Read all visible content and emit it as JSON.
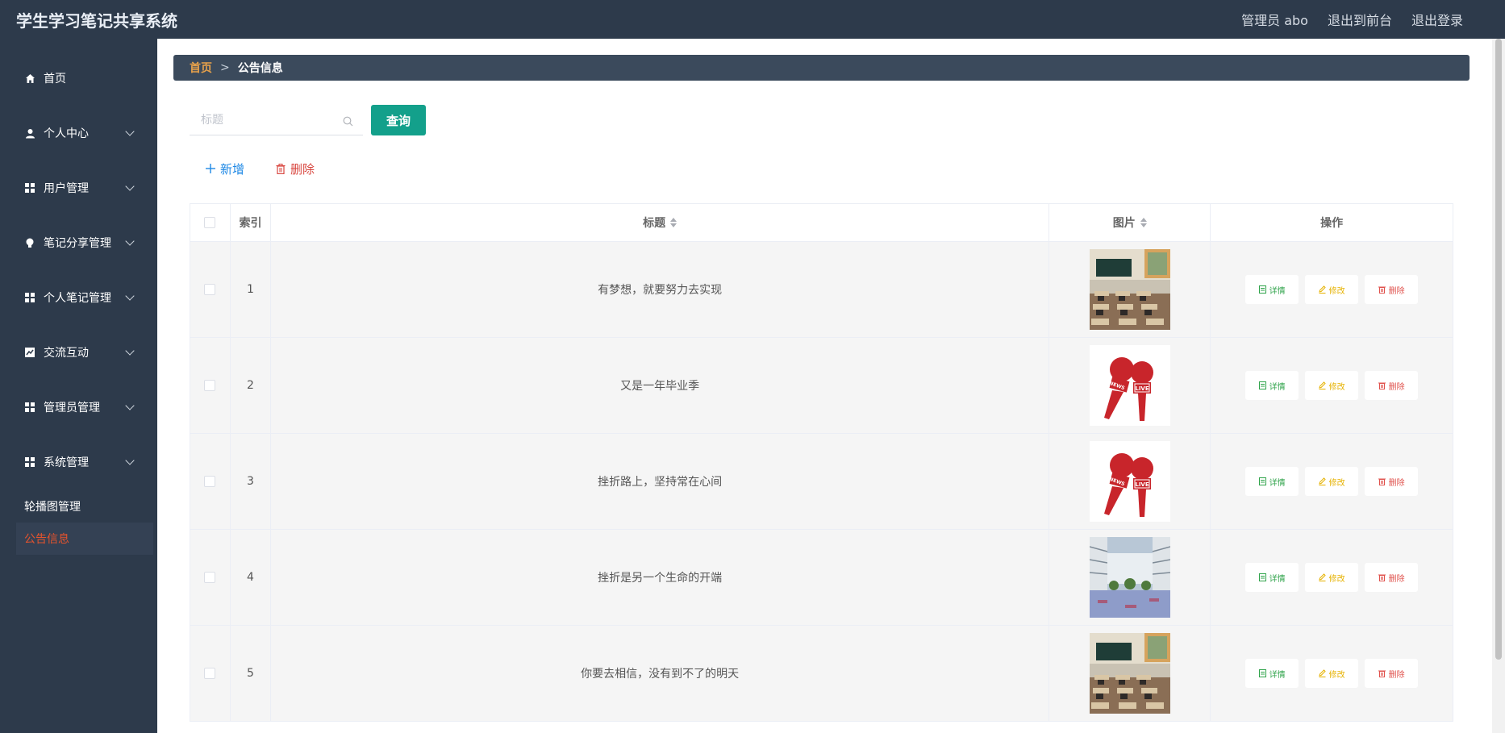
{
  "header": {
    "title": "学生学习笔记共享系统",
    "admin_label": "管理员 abo",
    "to_front": "退出到前台",
    "logout": "退出登录"
  },
  "sidebar": {
    "items": [
      {
        "label": "首页",
        "icon": "home-icon",
        "has_children": false
      },
      {
        "label": "个人中心",
        "icon": "user-icon",
        "has_children": true
      },
      {
        "label": "用户管理",
        "icon": "grid-icon",
        "has_children": true
      },
      {
        "label": "笔记分享管理",
        "icon": "bulb-icon",
        "has_children": true
      },
      {
        "label": "个人笔记管理",
        "icon": "grid-icon",
        "has_children": true
      },
      {
        "label": "交流互动",
        "icon": "chart-icon",
        "has_children": true
      },
      {
        "label": "管理员管理",
        "icon": "grid-icon",
        "has_children": true
      },
      {
        "label": "系统管理",
        "icon": "grid-icon",
        "has_children": true
      }
    ],
    "sub_items": [
      {
        "label": "轮播图管理",
        "active": false
      },
      {
        "label": "公告信息",
        "active": true
      }
    ]
  },
  "breadcrumb": {
    "home": "首页",
    "separator": ">",
    "current": "公告信息"
  },
  "search": {
    "placeholder": "标题",
    "value": "",
    "query_label": "查询"
  },
  "actions": {
    "add_label": "新增",
    "delete_label": "删除"
  },
  "table": {
    "columns": [
      "索引",
      "标题",
      "图片",
      "操作"
    ],
    "rows": [
      {
        "index": "1",
        "title": "有梦想，就要努力去实现",
        "image": "classroom"
      },
      {
        "index": "2",
        "title": "又是一年毕业季",
        "image": "microphones"
      },
      {
        "index": "3",
        "title": "挫折路上，坚持常在心间",
        "image": "microphones"
      },
      {
        "index": "4",
        "title": "挫折是另一个生命的开端",
        "image": "building"
      },
      {
        "index": "5",
        "title": "你要去相信，没有到不了的明天",
        "image": "classroom"
      }
    ],
    "op_labels": {
      "detail": "详情",
      "edit": "修改",
      "remove": "删除"
    },
    "mic_badge": "LIVE",
    "mic_badge_top": "NEWS"
  },
  "colors": {
    "sidebar_bg": "#2d3a4b",
    "accent": "#13a08b",
    "active_menu": "#e5532d",
    "breadcrumb_home": "#e9a24a"
  }
}
